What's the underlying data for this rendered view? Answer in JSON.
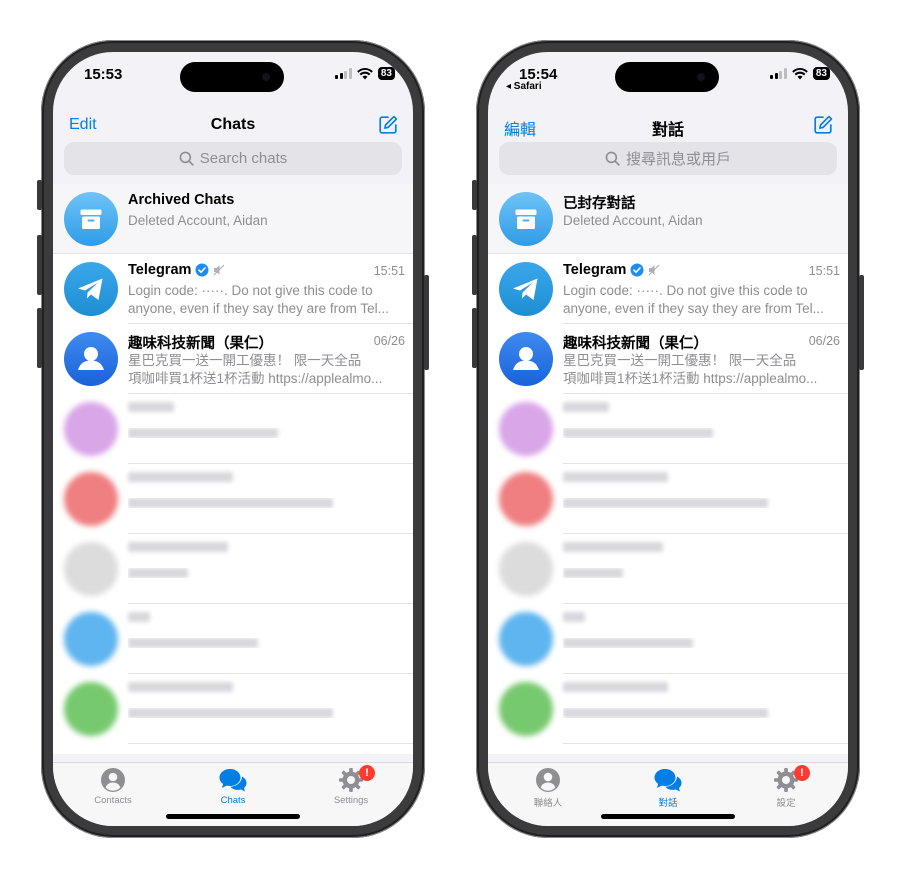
{
  "phones": [
    {
      "status": {
        "time": "15:53",
        "back_app": "",
        "battery": "83"
      },
      "nav": {
        "edit": "Edit",
        "title": "Chats"
      },
      "search": {
        "placeholder": "Search chats"
      },
      "archived": {
        "name": "Archived Chats",
        "preview": "Deleted Account, Aidan"
      },
      "telegram": {
        "name": "Telegram",
        "time": "15:51",
        "line1": "Login code: ·····. Do not give this code to",
        "line2": "anyone, even if they say they are from Tel..."
      },
      "news": {
        "name": "趣味科技新聞（果仁）",
        "time": "06/26",
        "line1": "星巴克買一送一開工優惠！ 限一天全品",
        "line2": "項咖啡買1杯送1杯活動 https://applealmo..."
      },
      "tabs": {
        "contacts": "Contacts",
        "chats": "Chats",
        "settings": "Settings",
        "badge": "!"
      }
    },
    {
      "status": {
        "time": "15:54",
        "back_app": "◂ Safari",
        "battery": "83"
      },
      "nav": {
        "edit": "編輯",
        "title": "對話"
      },
      "search": {
        "placeholder": "搜尋訊息或用戶"
      },
      "archived": {
        "name": "已封存對話",
        "preview": "Deleted Account, Aidan"
      },
      "telegram": {
        "name": "Telegram",
        "time": "15:51",
        "line1": "Login code: ·····. Do not give this code to",
        "line2": "anyone, even if they say they are from Tel..."
      },
      "news": {
        "name": "趣味科技新聞（果仁）",
        "time": "06/26",
        "line1": "星巴克買一送一開工優惠！ 限一天全品",
        "line2": "項咖啡買1杯送1杯活動 https://applealmo..."
      },
      "tabs": {
        "contacts": "聯絡人",
        "chats": "對話",
        "settings": "設定",
        "badge": "!"
      }
    }
  ],
  "colors": {
    "accent": "#037ee5",
    "badge": "#ff3b30",
    "telegram_blue": "#2aa0e8"
  },
  "icons": [
    "archive-icon",
    "telegram-plane-icon",
    "verified-badge-icon",
    "muted-icon",
    "search-icon",
    "compose-icon",
    "person-icon",
    "chat-bubbles-icon",
    "gear-icon"
  ]
}
